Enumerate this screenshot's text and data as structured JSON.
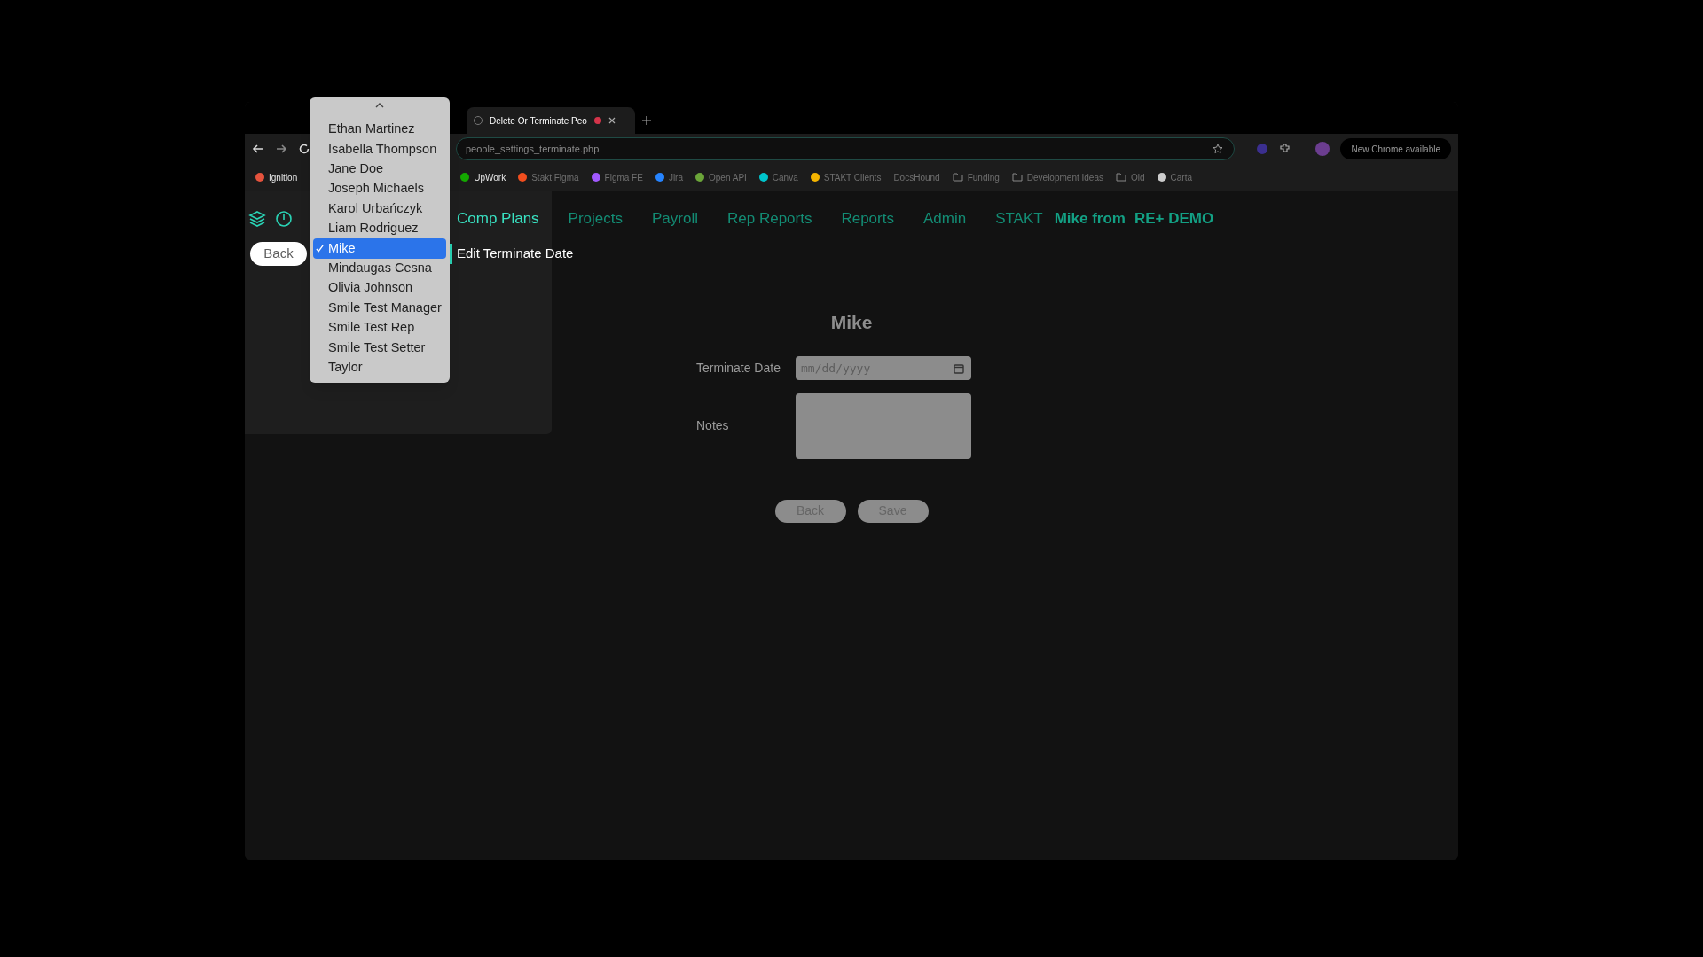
{
  "tabs": [
    {
      "label": "Delete Or Terminate Peo",
      "selected": true
    }
  ],
  "address_bar": {
    "url": "people_settings_terminate.php"
  },
  "chrome_update": "New Chrome available",
  "bookmarks": [
    {
      "label": "Ignition",
      "kind": "site",
      "color": "#e5533d"
    },
    {
      "label": "UpWork",
      "kind": "site",
      "color": "#14a800"
    },
    {
      "label": "Stakt Figma",
      "kind": "site",
      "color": "#f24e1e"
    },
    {
      "label": "Figma FE",
      "kind": "site",
      "color": "#a259ff"
    },
    {
      "label": "Jira",
      "kind": "site",
      "color": "#2684ff"
    },
    {
      "label": "Open API",
      "kind": "site",
      "color": "#6ba539"
    },
    {
      "label": "Canva",
      "kind": "site",
      "color": "#00c4cc"
    },
    {
      "label": "STAKT Clients",
      "kind": "site",
      "color": "#f4b400"
    },
    {
      "label": "DocsHound",
      "kind": "text"
    },
    {
      "label": "Funding",
      "kind": "folder"
    },
    {
      "label": "Development Ideas",
      "kind": "folder"
    },
    {
      "label": "Old",
      "kind": "folder"
    },
    {
      "label": "Carta",
      "kind": "site",
      "color": "#cccccc"
    }
  ],
  "nav": {
    "items": [
      {
        "label": "Comp Plans",
        "selected": true
      },
      {
        "label": "Projects",
        "selected": false
      },
      {
        "label": "Payroll",
        "selected": false
      },
      {
        "label": "Rep Reports",
        "selected": false
      },
      {
        "label": "Reports",
        "selected": false
      },
      {
        "label": "Admin",
        "selected": false
      },
      {
        "label": "STAKT",
        "selected": false
      }
    ],
    "user": "Mike from",
    "company": "RE+ DEMO"
  },
  "back_button": "Back",
  "page_heading": "Edit Terminate Date",
  "dropdown": {
    "options": [
      {
        "label": "Ethan Martinez",
        "selected": false
      },
      {
        "label": "Isabella Thompson",
        "selected": false
      },
      {
        "label": "Jane Doe",
        "selected": false
      },
      {
        "label": "Joseph Michaels",
        "selected": false
      },
      {
        "label": "Karol Urbańczyk",
        "selected": false
      },
      {
        "label": "Liam Rodriguez",
        "selected": false
      },
      {
        "label": "Mike",
        "selected": true
      },
      {
        "label": "Mindaugas Cesna",
        "selected": false
      },
      {
        "label": "Olivia Johnson",
        "selected": false
      },
      {
        "label": "Smile Test Manager",
        "selected": false
      },
      {
        "label": "Smile Test Rep",
        "selected": false
      },
      {
        "label": "Smile Test Setter",
        "selected": false
      },
      {
        "label": "Taylor",
        "selected": false
      }
    ]
  },
  "form": {
    "title": "Mike",
    "fields": [
      {
        "kind": "date",
        "label": "Terminate Date",
        "placeholder": "mm/dd/yyyy"
      },
      {
        "kind": "textarea",
        "label": "Notes"
      }
    ],
    "buttons": [
      "Back",
      "Save"
    ]
  }
}
